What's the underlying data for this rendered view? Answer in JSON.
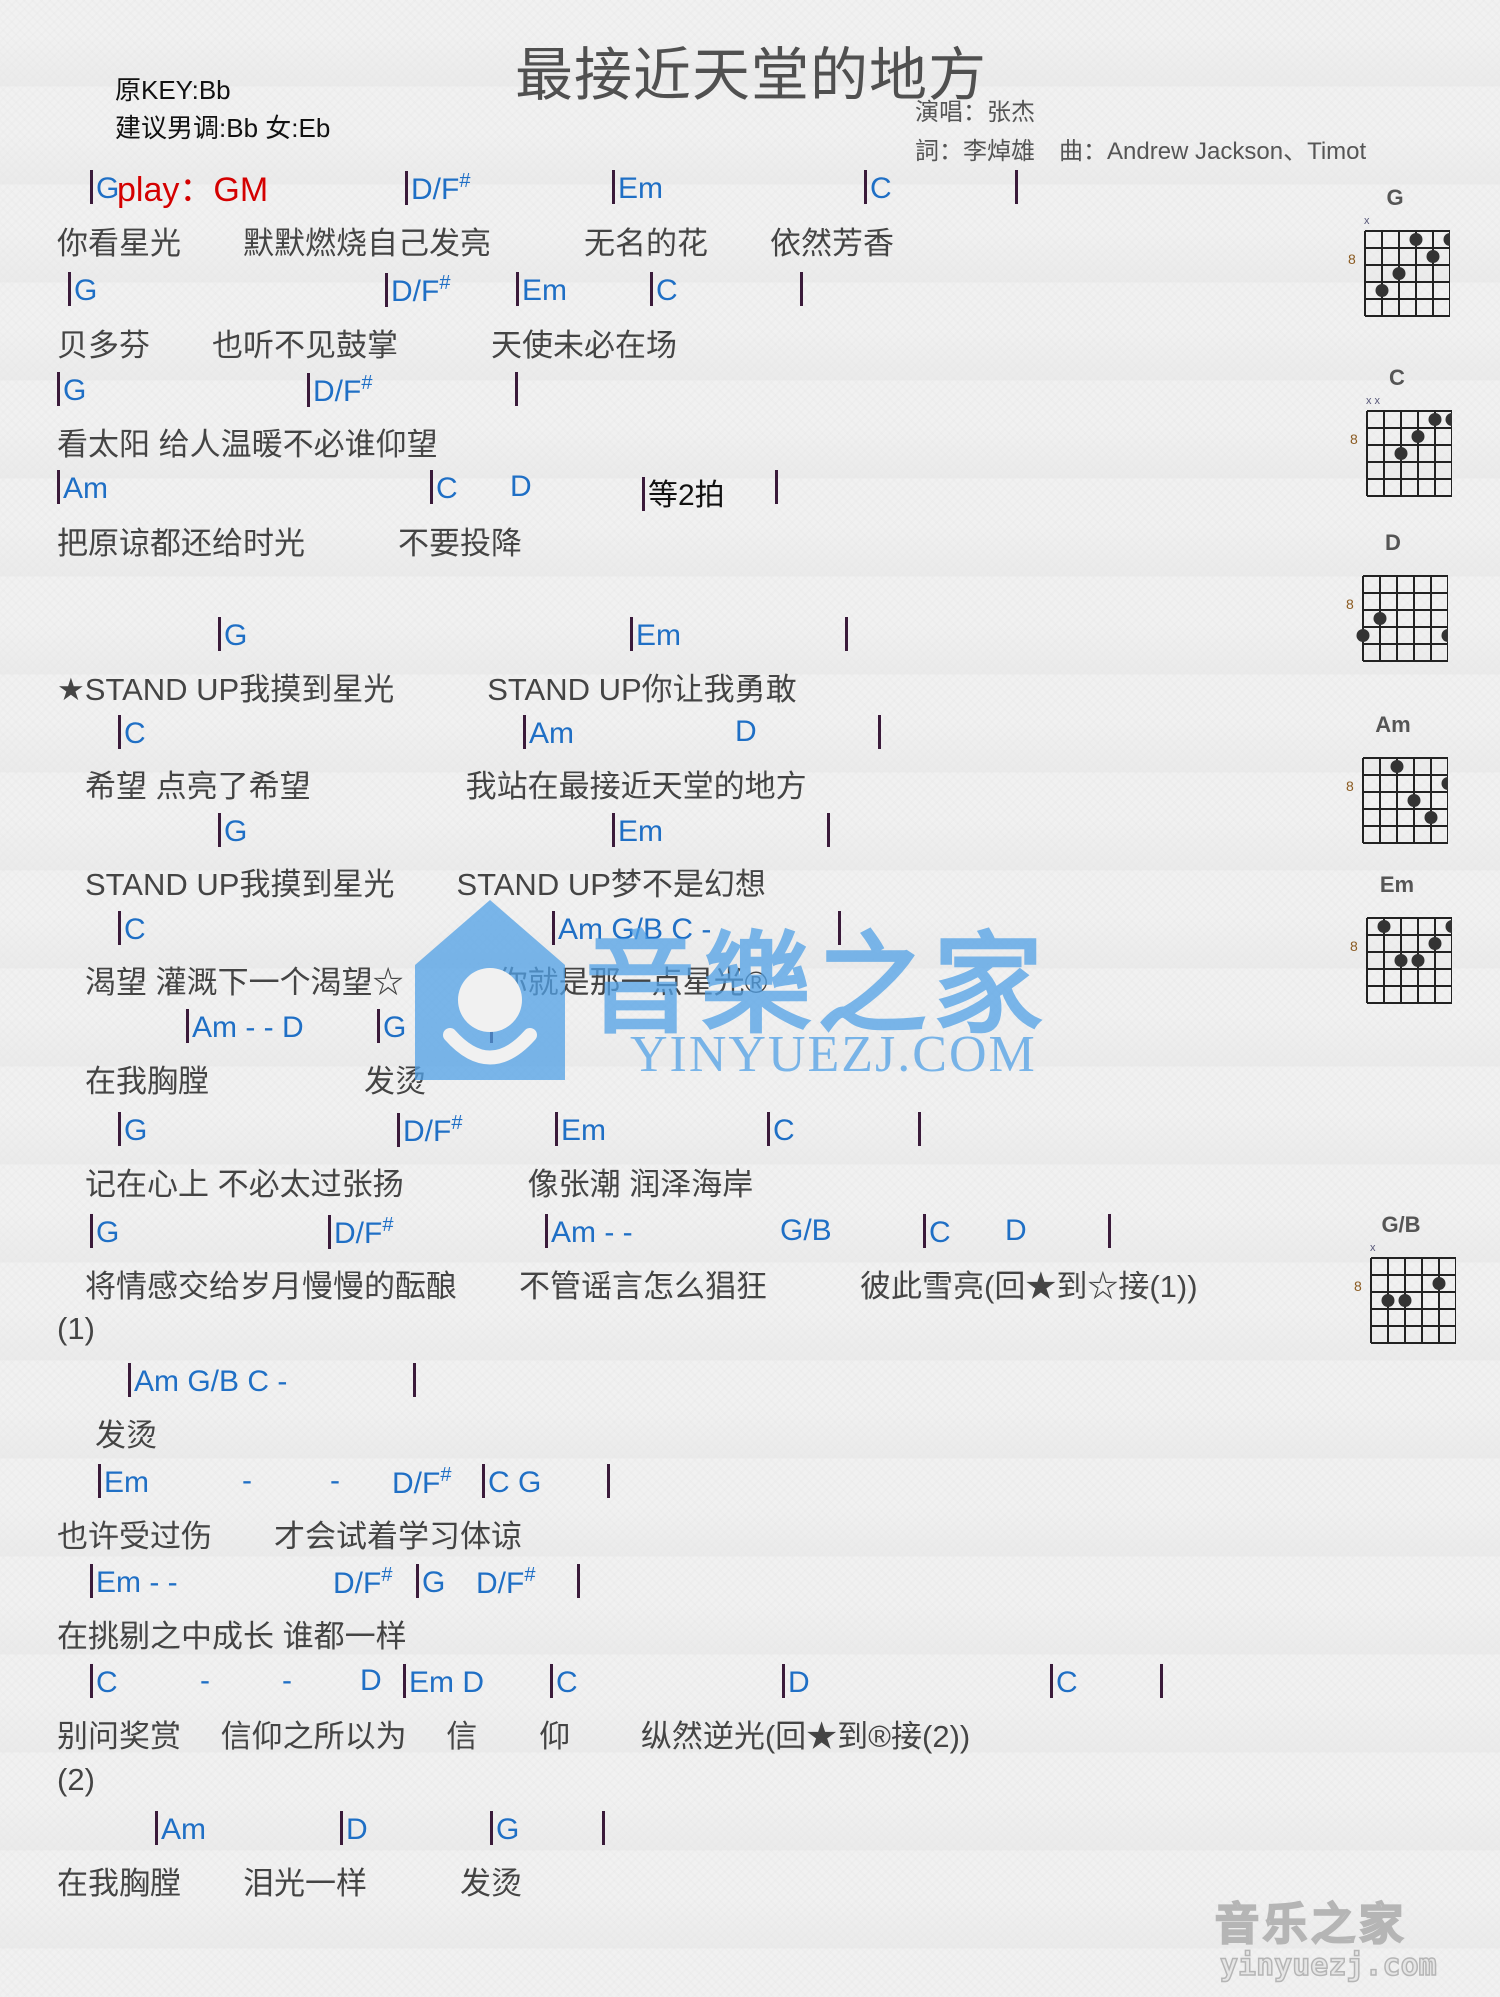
{
  "header": {
    "title": "最接近天堂的地方",
    "original_key": "原KEY:Bb",
    "suggested_key": "建议男调:Bb 女:Eb",
    "play_key": "play：GM",
    "singer": "演唱：张杰",
    "credits": "詞：李焯雄　曲：Andrew Jackson、Timot"
  },
  "lines": [
    {
      "chords": [
        {
          "t": "G",
          "bar": true
        },
        {
          "t": "D/F",
          "sup": "#",
          "bar": true
        },
        {
          "t": "Em",
          "bar": true
        },
        {
          "t": "C",
          "bar": true
        },
        {
          "t": "",
          "bar": true
        }
      ],
      "lyric": "你看星光　　默默燃烧自己发亮　　　无名的花　　依然芳香"
    },
    {
      "chords": [
        {
          "t": "G",
          "bar": true
        },
        {
          "t": "D/F",
          "sup": "#",
          "bar": true
        },
        {
          "t": "Em",
          "bar": true
        },
        {
          "t": "C",
          "bar": true
        },
        {
          "t": "",
          "bar": true
        }
      ],
      "lyric": "贝多芬　　也听不见鼓掌　　　天使未必在场"
    },
    {
      "chords": [
        {
          "t": "G",
          "bar": true
        },
        {
          "t": "D/F",
          "sup": "#",
          "bar": true
        },
        {
          "t": "",
          "bar": true
        }
      ],
      "lyric": "看太阳 给人温暖不必谁仰望"
    },
    {
      "chords": [
        {
          "t": "Am",
          "bar": true
        },
        {
          "t": "C",
          "bar": true
        },
        {
          "t": "D",
          "bar": false
        },
        {
          "t": "等2拍",
          "bar": true,
          "black": true
        },
        {
          "t": "",
          "bar": true
        }
      ],
      "lyric": "把原谅都还给时光　　　不要投降"
    },
    {
      "chords": [
        {
          "t": "G",
          "bar": true
        },
        {
          "t": "Em",
          "bar": true
        },
        {
          "t": "",
          "bar": true
        }
      ],
      "lyric": "★STAND UP我摸到星光　　　STAND UP你让我勇敢"
    },
    {
      "chords": [
        {
          "t": "C",
          "bar": true
        },
        {
          "t": "Am",
          "bar": true
        },
        {
          "t": "D",
          "bar": false
        },
        {
          "t": "",
          "bar": true
        }
      ],
      "lyric": "希望 点亮了希望　　　　　我站在最接近天堂的地方"
    },
    {
      "chords": [
        {
          "t": "G",
          "bar": true
        },
        {
          "t": "Em",
          "bar": true
        },
        {
          "t": "",
          "bar": true
        }
      ],
      "lyric": "STAND UP我摸到星光　　STAND UP梦不是幻想"
    },
    {
      "chords": [
        {
          "t": "C",
          "bar": true
        },
        {
          "t": "Am  G/B    C  -",
          "bar": true
        },
        {
          "t": "",
          "bar": true
        }
      ],
      "lyric": "渴望 灌溉下一个渴望☆　　　你就是那一点星光®"
    },
    {
      "chords": [
        {
          "t": "Am -  -  D",
          "bar": true
        },
        {
          "t": "G",
          "bar": true
        },
        {
          "t": "",
          "bar": true
        }
      ],
      "lyric": "在我胸膛　　　　　发烫"
    },
    {
      "chords": [
        {
          "t": "G",
          "bar": true
        },
        {
          "t": "D/F",
          "sup": "#",
          "bar": true
        },
        {
          "t": "Em",
          "bar": true
        },
        {
          "t": "C",
          "bar": true
        },
        {
          "t": "",
          "bar": true
        }
      ],
      "lyric": "记在心上 不必太过张扬　　　　像张潮 润泽海岸"
    },
    {
      "chords": [
        {
          "t": "G",
          "bar": true
        },
        {
          "t": "D/F",
          "sup": "#",
          "bar": true
        },
        {
          "t": "Am   -   -",
          "bar": true
        },
        {
          "t": "G/B",
          "bar": false
        },
        {
          "t": "C",
          "bar": true
        },
        {
          "t": "D",
          "bar": false
        },
        {
          "t": "",
          "bar": true
        }
      ],
      "lyric": "将情感交给岁月慢慢的酝酿　　不管谣言怎么猖狂　　　彼此雪亮(回★到☆接(1))"
    },
    {
      "chords": [],
      "lyric": "(1)"
    },
    {
      "chords": [
        {
          "t": "Am  G/B     C  -",
          "bar": true
        },
        {
          "t": "",
          "bar": true
        }
      ],
      "lyric": "发烫"
    },
    {
      "chords": [
        {
          "t": "Em",
          "bar": true
        },
        {
          "t": "-",
          "bar": false
        },
        {
          "t": "-",
          "bar": false
        },
        {
          "t": "D/F",
          "sup": "#",
          "bar": false
        },
        {
          "t": "C   G",
          "bar": true
        },
        {
          "t": "",
          "bar": true
        }
      ],
      "lyric": "也许受过伤　　才会试着学习体谅"
    },
    {
      "chords": [
        {
          "t": "Em   -    -",
          "bar": true
        },
        {
          "t": "D/F",
          "sup": "#",
          "bar": false
        },
        {
          "t": "G",
          "bar": true
        },
        {
          "t": "D/F",
          "sup": "#",
          "bar": false
        },
        {
          "t": "",
          "bar": true
        }
      ],
      "lyric": "在挑剔之中成长 谁都一样"
    },
    {
      "chords": [
        {
          "t": "C",
          "bar": true
        },
        {
          "t": "-",
          "bar": false
        },
        {
          "t": "-",
          "bar": false
        },
        {
          "t": "D",
          "bar": false
        },
        {
          "t": "Em   D",
          "bar": true
        },
        {
          "t": "C",
          "bar": true
        },
        {
          "t": "D",
          "bar": true
        },
        {
          "t": "C",
          "bar": true
        },
        {
          "t": "",
          "bar": true
        }
      ],
      "lyric": "别问奖赏　 信仰之所以为　 信　　仰　　 纵然逆光(回★到®接(2))"
    },
    {
      "chords": [],
      "lyric": "(2)"
    },
    {
      "chords": [
        {
          "t": "Am",
          "bar": true
        },
        {
          "t": "D",
          "bar": true
        },
        {
          "t": "G",
          "bar": true
        },
        {
          "t": "",
          "bar": true
        }
      ],
      "lyric": "在我胸膛　　泪光一样　　　发烫"
    }
  ],
  "chord_diagrams": [
    {
      "name": "G",
      "fret": "8",
      "muted": "x"
    },
    {
      "name": "C",
      "fret": "8",
      "muted": "x x"
    },
    {
      "name": "D",
      "fret": "8",
      "muted": ""
    },
    {
      "name": "Am",
      "fret": "8",
      "muted": ""
    },
    {
      "name": "Em",
      "fret": "8",
      "muted": ""
    },
    {
      "name": "G/B",
      "fret": "8",
      "muted": "x"
    }
  ],
  "watermark": {
    "center_cn": "音樂之家",
    "center_en": "YINYUEZJ.COM",
    "corner_cn": "音乐之家",
    "corner_en": "yinyuezj.com"
  },
  "colors": {
    "chord": "#1f6fc5",
    "play": "#d40000",
    "lyric": "#444444"
  }
}
